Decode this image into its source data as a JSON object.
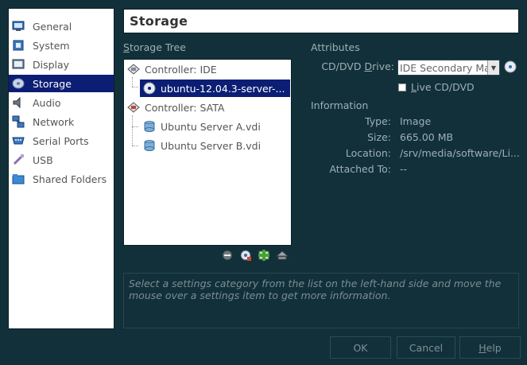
{
  "categories": [
    {
      "label": "General",
      "icon": "monitor-icon"
    },
    {
      "label": "System",
      "icon": "chip-icon"
    },
    {
      "label": "Display",
      "icon": "display-icon"
    },
    {
      "label": "Storage",
      "icon": "disk-icon",
      "selected": true
    },
    {
      "label": "Audio",
      "icon": "speaker-icon"
    },
    {
      "label": "Network",
      "icon": "network-icon"
    },
    {
      "label": "Serial Ports",
      "icon": "serial-port-icon"
    },
    {
      "label": "USB",
      "icon": "usb-icon"
    },
    {
      "label": "Shared Folders",
      "icon": "folder-icon"
    }
  ],
  "page_title": "Storage",
  "storage_tree": {
    "label_prefix": "S",
    "label_rest": "torage Tree",
    "items": [
      {
        "label": "Controller: IDE",
        "icon": "ide-controller-icon"
      },
      {
        "label": "ubuntu-12.04.3-server-...",
        "icon": "cd-icon",
        "selected": true
      },
      {
        "label": "Controller: SATA",
        "icon": "sata-controller-icon"
      },
      {
        "label": "Ubuntu Server A.vdi",
        "icon": "hard-disk-icon"
      },
      {
        "label": "Ubuntu Server B.vdi",
        "icon": "hard-disk-icon"
      }
    ]
  },
  "attributes": {
    "heading": "Attributes",
    "drive_label_prefix": "CD/DVD ",
    "drive_label_u": "D",
    "drive_label_rest": "rive:",
    "drive_value": "IDE Secondary Master",
    "live_prefix": "",
    "live_u": "L",
    "live_rest": "ive CD/DVD"
  },
  "information": {
    "heading": "Information",
    "rows": [
      {
        "label": "Type:",
        "value": "Image"
      },
      {
        "label": "Size:",
        "value": "665.00 MB"
      },
      {
        "label": "Location:",
        "value": "/srv/media/software/Li..."
      },
      {
        "label": "Attached To:",
        "value": "--"
      }
    ]
  },
  "help_text": "Select a settings category from the list on the left-hand side and move the mouse over a settings item to get more information.",
  "buttons": {
    "ok": "OK",
    "cancel": "Cancel",
    "help_prefix": "",
    "help_u": "H",
    "help_rest": "elp"
  }
}
